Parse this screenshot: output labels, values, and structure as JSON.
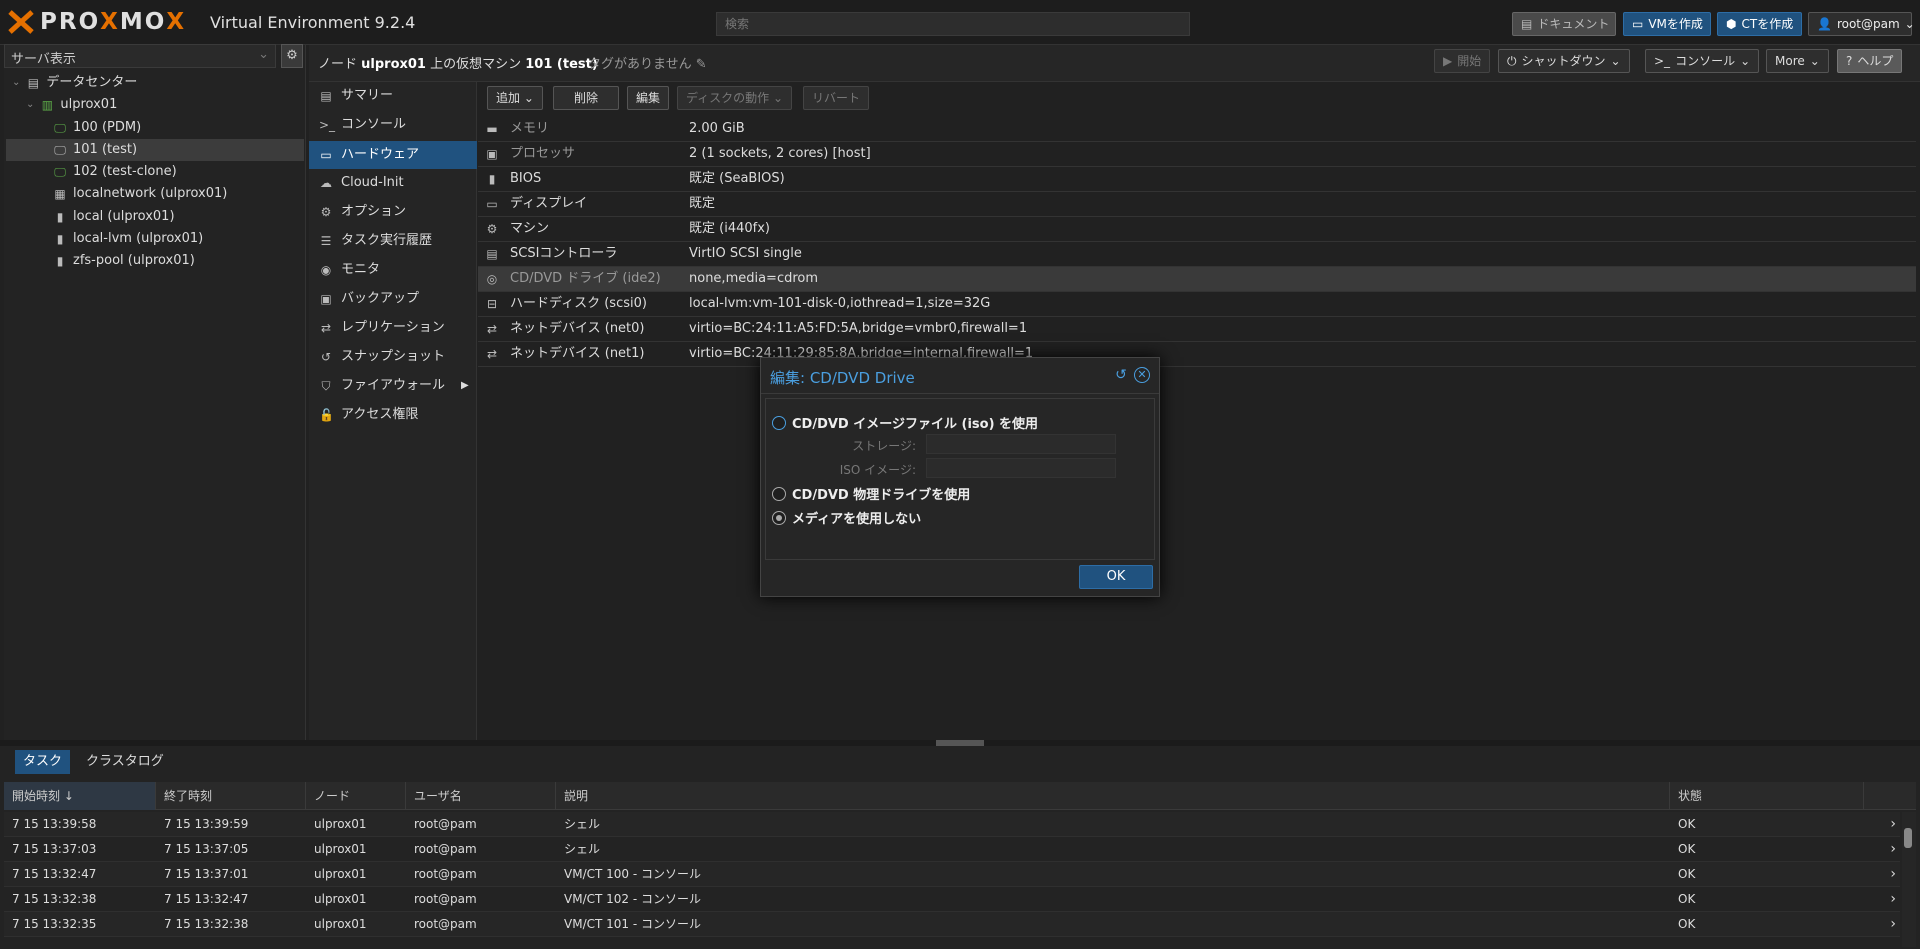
{
  "app": {
    "logo_x": "✕",
    "logo_text_1": "PRO",
    "logo_x2": "X",
    "logo_text_2": "MO",
    "logo_x3": "X",
    "version": "Virtual Environment 9.2.4",
    "search_placeholder": "検索",
    "buttons": {
      "docs": "ドキュメント",
      "create_vm": "VMを作成",
      "create_ct": "CTを作成",
      "user": "root@pam"
    },
    "accent": "#20527f",
    "brand": "#e57000"
  },
  "tree": {
    "view": "サーバ表示",
    "items": [
      {
        "label": "データセンター",
        "icon": "datacenter-icon"
      },
      {
        "label": "ulprox01",
        "icon": "node-icon"
      },
      {
        "label": "100 (PDM)",
        "icon": "vm-running-icon"
      },
      {
        "label": "101 (test)",
        "icon": "vm-icon"
      },
      {
        "label": "102 (test-clone)",
        "icon": "vm-running-icon"
      },
      {
        "label": "localnetwork (ulprox01)",
        "icon": "network-icon"
      },
      {
        "label": "local (ulprox01)",
        "icon": "storage-icon"
      },
      {
        "label": "local-lvm (ulprox01)",
        "icon": "storage-icon"
      },
      {
        "label": "zfs-pool (ulprox01)",
        "icon": "storage-icon"
      }
    ]
  },
  "header": {
    "title_prefix": "ノード ",
    "node": "ulprox01",
    "title_mid": " 上の仮想マシン ",
    "vm": "101 (test)",
    "tags": "タグがありません",
    "buttons": {
      "start": "開始",
      "shutdown": "シャットダウン",
      "console": "コンソール",
      "more": "More",
      "help": "ヘルプ"
    }
  },
  "nav": {
    "items": [
      {
        "label": "サマリー",
        "icon": "summary-icon"
      },
      {
        "label": "コンソール",
        "icon": "console-icon"
      },
      {
        "label": "ハードウェア",
        "icon": "hardware-icon"
      },
      {
        "label": "Cloud-Init",
        "icon": "cloud-icon"
      },
      {
        "label": "オプション",
        "icon": "options-icon"
      },
      {
        "label": "タスク実行履歴",
        "icon": "task-history-icon"
      },
      {
        "label": "モニタ",
        "icon": "monitor-icon"
      },
      {
        "label": "バックアップ",
        "icon": "backup-icon"
      },
      {
        "label": "レプリケーション",
        "icon": "replication-icon"
      },
      {
        "label": "スナップショット",
        "icon": "snapshot-icon"
      },
      {
        "label": "ファイアウォール",
        "icon": "firewall-icon"
      },
      {
        "label": "アクセス権限",
        "icon": "permissions-icon"
      }
    ]
  },
  "hw_toolbar": {
    "add": "追加",
    "remove": "削除",
    "edit": "編集",
    "disk_action": "ディスクの動作",
    "revert": "リバート"
  },
  "hardware": [
    {
      "key": "メモリ",
      "value": "2.00 GiB",
      "icon": "memory-icon"
    },
    {
      "key": "プロセッサ",
      "value": "2 (1 sockets, 2 cores) [host]",
      "icon": "cpu-icon"
    },
    {
      "key": "BIOS",
      "value": "既定 (SeaBIOS)",
      "icon": "bios-icon"
    },
    {
      "key": "ディスプレイ",
      "value": "既定",
      "icon": "display-icon"
    },
    {
      "key": "マシン",
      "value": "既定 (i440fx)",
      "icon": "machine-icon"
    },
    {
      "key": "SCSIコントローラ",
      "value": "VirtIO SCSI single",
      "icon": "scsi-icon"
    },
    {
      "key": "CD/DVD ドライブ (ide2)",
      "value": "none,media=cdrom",
      "icon": "cdrom-icon"
    },
    {
      "key": "ハードディスク (scsi0)",
      "value": "local-lvm:vm-101-disk-0,iothread=1,size=32G",
      "icon": "harddisk-icon"
    },
    {
      "key": "ネットデバイス (net0)",
      "value": "virtio=BC:24:11:A5:FD:5A,bridge=vmbr0,firewall=1",
      "icon": "network-device-icon"
    },
    {
      "key": "ネットデバイス (net1)",
      "value": "virtio=BC:24:11:29:85:8A,bridge=internal,firewall=1",
      "icon": "network-device-icon"
    }
  ],
  "modal": {
    "title": "編集: CD/DVD Drive",
    "opt_iso": "CD/DVD イメージファイル (iso) を使用",
    "storage_label": "ストレージ:",
    "iso_label": "ISO イメージ:",
    "opt_physical": "CD/DVD 物理ドライブを使用",
    "opt_none": "メディアを使用しない",
    "selected": "opt_none",
    "ok": "OK"
  },
  "tasks": {
    "tabs": [
      "タスク",
      "クラスタログ"
    ],
    "columns": [
      "開始時刻 ↓",
      "終了時刻",
      "ノード",
      "ユーザ名",
      "説明",
      "状態"
    ],
    "rows": [
      [
        "7 15 13:39:58",
        "7 15 13:39:59",
        "ulprox01",
        "root@pam",
        "シェル",
        "OK"
      ],
      [
        "7 15 13:37:03",
        "7 15 13:37:05",
        "ulprox01",
        "root@pam",
        "シェル",
        "OK"
      ],
      [
        "7 15 13:32:47",
        "7 15 13:37:01",
        "ulprox01",
        "root@pam",
        "VM/CT 100 - コンソール",
        "OK"
      ],
      [
        "7 15 13:32:38",
        "7 15 13:32:47",
        "ulprox01",
        "root@pam",
        "VM/CT 102 - コンソール",
        "OK"
      ],
      [
        "7 15 13:32:35",
        "7 15 13:32:38",
        "ulprox01",
        "root@pam",
        "VM/CT 101 - コンソール",
        "OK"
      ]
    ]
  }
}
